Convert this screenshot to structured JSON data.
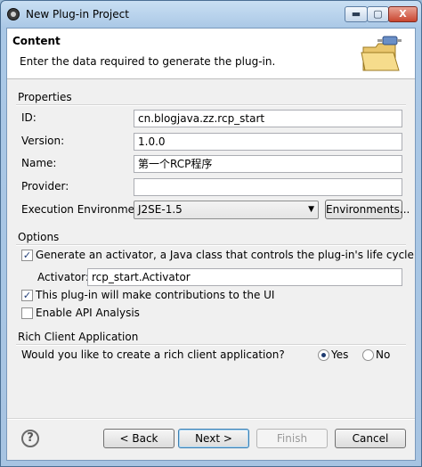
{
  "window": {
    "title": "New Plug-in Project",
    "min_label": "▬",
    "max_label": "▢",
    "close_label": "X"
  },
  "header": {
    "title": "Content",
    "description": "Enter the data required to generate the plug-in."
  },
  "properties": {
    "group_label": "Properties",
    "id_label": "ID:",
    "id_value": "cn.blogjava.zz.rcp_start",
    "version_label": "Version:",
    "version_value": "1.0.0",
    "name_label": "Name:",
    "name_value": "第一个RCP程序",
    "provider_label": "Provider:",
    "provider_value": "",
    "env_label": "Execution Environment:",
    "env_value": "J2SE-1.5",
    "environments_button": "Environments..."
  },
  "options": {
    "group_label": "Options",
    "generate_activator_label": "Generate an activator, a Java class that controls the plug-in's life cycle",
    "generate_activator_checked": true,
    "activator_label": "Activator:",
    "activator_value": "rcp_start.Activator",
    "ui_contrib_label": "This plug-in will make contributions to the UI",
    "ui_contrib_checked": true,
    "api_analysis_label": "Enable API Analysis",
    "api_analysis_checked": false
  },
  "rich_client": {
    "group_label": "Rich Client Application",
    "question": "Would you like to create a rich client application?",
    "yes_label": "Yes",
    "no_label": "No",
    "selected": "Yes"
  },
  "footer": {
    "back": "< Back",
    "next": "Next >",
    "finish": "Finish",
    "cancel": "Cancel",
    "help_glyph": "?"
  },
  "icons": {
    "help": "help-icon",
    "banner": "plugin-folder-icon",
    "dropdown": "chevron-down-icon",
    "app": "eclipse-icon"
  }
}
